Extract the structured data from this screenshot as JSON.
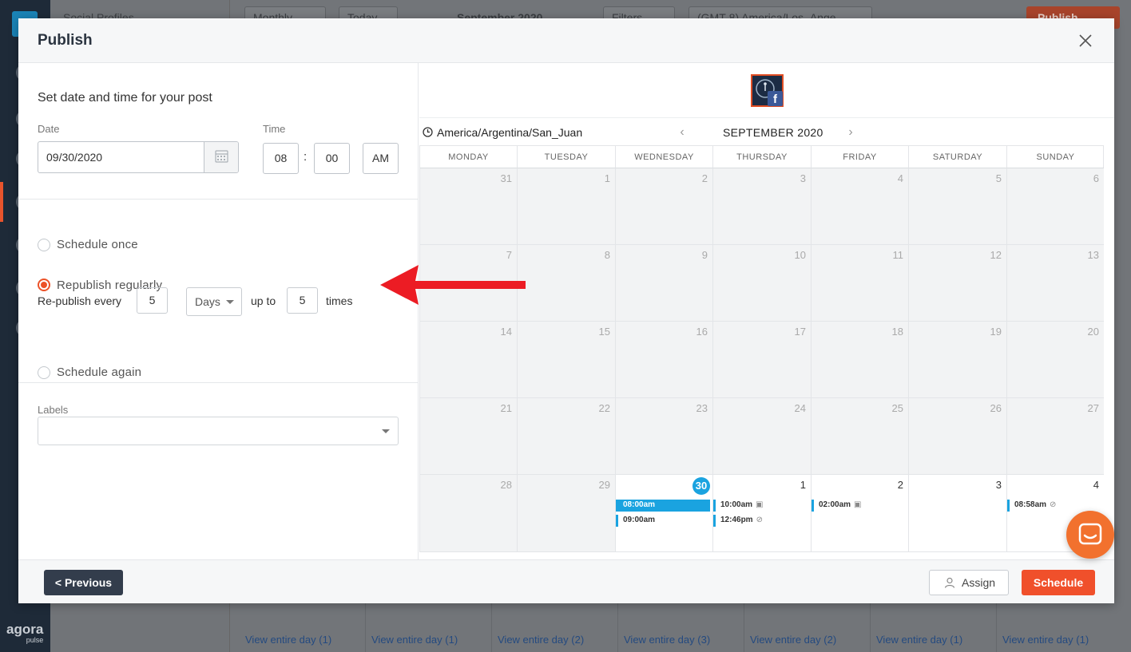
{
  "background": {
    "sidebar_header": "Social Profiles",
    "view_mode": "Monthly",
    "today_label": "Today",
    "month_title": "September 2020",
    "filters_label": "Filters",
    "timezone": "(GMT-8) America/Los_Ange",
    "publish_label": "Publish",
    "brand_name": "agora",
    "brand_sub": "pulse",
    "view_links": [
      "View entire day (1)",
      "View entire day (1)",
      "View entire day (2)",
      "View entire day (3)",
      "View entire day (2)",
      "View entire day (1)",
      "View entire day (1)"
    ]
  },
  "modal": {
    "title": "Publish",
    "section_title": "Set date and time for your post",
    "date_label": "Date",
    "date_value": "09/30/2020",
    "time_label": "Time",
    "hour": "08",
    "minute": "00",
    "ampm": "AM",
    "colon": ":",
    "options": {
      "once": "Schedule once",
      "republish": "Republish regularly",
      "again": "Schedule again"
    },
    "republish": {
      "prefix": "Re-publish every",
      "every_value": "5",
      "unit": "Days",
      "upto_label": "up to",
      "times_value": "5",
      "suffix": "times"
    },
    "labels_label": "Labels"
  },
  "calendar": {
    "timezone": "America/Argentina/San_Juan",
    "month": "SEPTEMBER 2020",
    "weekdays": [
      "MONDAY",
      "TUESDAY",
      "WEDNESDAY",
      "THURSDAY",
      "FRIDAY",
      "SATURDAY",
      "SUNDAY"
    ],
    "weeks": [
      [
        "31",
        "1",
        "2",
        "3",
        "4",
        "5",
        "6"
      ],
      [
        "7",
        "8",
        "9",
        "10",
        "11",
        "12",
        "13"
      ],
      [
        "14",
        "15",
        "16",
        "17",
        "18",
        "19",
        "20"
      ],
      [
        "21",
        "22",
        "23",
        "24",
        "25",
        "26",
        "27"
      ],
      [
        "28",
        "29",
        "30",
        "1",
        "2",
        "3",
        "4"
      ]
    ],
    "today": "30",
    "events": {
      "wed": [
        {
          "time": "08:00am",
          "selected": true
        },
        {
          "time": "09:00am"
        }
      ],
      "thu": [
        {
          "time": "10:00am",
          "icon": "image-icon"
        },
        {
          "time": "12:46pm",
          "icon": "link-icon"
        }
      ],
      "fri": [
        {
          "time": "02:00am",
          "icon": "image-icon"
        }
      ],
      "sun": [
        {
          "time": "08:58am",
          "icon": "link-icon"
        }
      ]
    }
  },
  "footer": {
    "previous": "< Previous",
    "assign": "Assign",
    "schedule": "Schedule"
  },
  "colors": {
    "accent": "#f0502b",
    "today": "#1aa3e0",
    "dark": "#333d4c"
  }
}
